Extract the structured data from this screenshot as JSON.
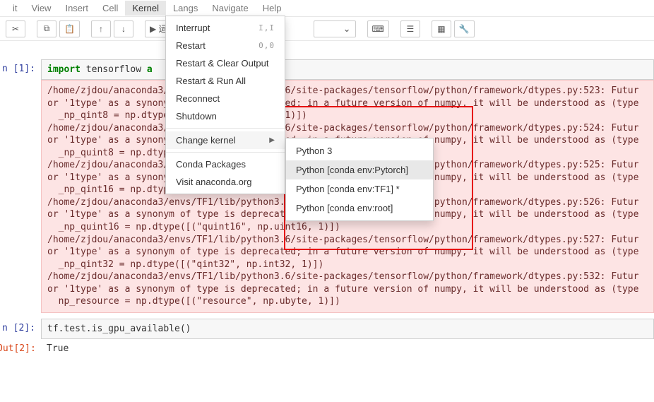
{
  "menubar": {
    "items": [
      "it",
      "View",
      "Insert",
      "Cell",
      "Kernel",
      "Langs",
      "Navigate",
      "Help"
    ],
    "active_index": 4
  },
  "toolbar": {
    "run_label": "运行",
    "dropdown_caret": "⌄"
  },
  "kernel_menu": {
    "interrupt": "Interrupt",
    "interrupt_keys": "I,I",
    "restart": "Restart",
    "restart_keys": "0,0",
    "restart_clear": "Restart & Clear Output",
    "restart_run": "Restart & Run All",
    "reconnect": "Reconnect",
    "shutdown": "Shutdown",
    "change_kernel": "Change kernel",
    "conda_packages": "Conda Packages",
    "visit_anaconda": "Visit anaconda.org"
  },
  "kernel_submenu": {
    "items": [
      "Python 3",
      "Python [conda env:Pytorch]",
      "Python [conda env:TF1] *",
      "Python [conda env:root]"
    ],
    "hover_index": 1
  },
  "cells": {
    "in1_prompt": "n [1]:",
    "in1_code_pre": "import",
    "in1_code_mid": " tensorflow ",
    "in1_code_post": "a",
    "err_text": "/home/zjdou/anaconda3/envs/TF1/lib/python3.6/site-packages/tensorflow/python/framework/dtypes.py:523: Futur\nor '1type' as a synonym of type is deprecated; in a future version of numpy, it will be understood as (type\n  _np_qint8 = np.dtype([(\"qint8\", np.int8, 1)])\n/home/zjdou/anaconda3/envs/TF1/lib/python3.6/site-packages/tensorflow/python/framework/dtypes.py:524: Futur\nor '1type' as a synonym of type is deprecated; in a future version of numpy, it will be understood as (type\n  _np_quint8 = np.dtype([(\"quint8\", np.uint8, 1)])\n/home/zjdou/anaconda3/envs/TF1/lib/python3.6/site-packages/tensorflow/python/framework/dtypes.py:525: Futur\nor '1type' as a synonym of type is deprecated; in a future version of numpy, it will be understood as (type\n  _np_qint16 = np.dtype([(\"qint16\", np.int16, 1)])\n/home/zjdou/anaconda3/envs/TF1/lib/python3.6/site-packages/tensorflow/python/framework/dtypes.py:526: Futur\nor '1type' as a synonym of type is deprecated; in a future version of numpy, it will be understood as (type\n  _np_quint16 = np.dtype([(\"quint16\", np.uint16, 1)])\n/home/zjdou/anaconda3/envs/TF1/lib/python3.6/site-packages/tensorflow/python/framework/dtypes.py:527: Futur\nor '1type' as a synonym of type is deprecated; in a future version of numpy, it will be understood as (type\n  _np_qint32 = np.dtype([(\"qint32\", np.int32, 1)])\n/home/zjdou/anaconda3/envs/TF1/lib/python3.6/site-packages/tensorflow/python/framework/dtypes.py:532: Futur\nor '1type' as a synonym of type is deprecated; in a future version of numpy, it will be understood as (type\n  np_resource = np.dtype([(\"resource\", np.ubyte, 1)])",
    "in2_prompt": "n [2]:",
    "in2_code": "tf.test.is_gpu_available()",
    "out2_prompt": "Out[2]:",
    "out2_value": "True"
  }
}
